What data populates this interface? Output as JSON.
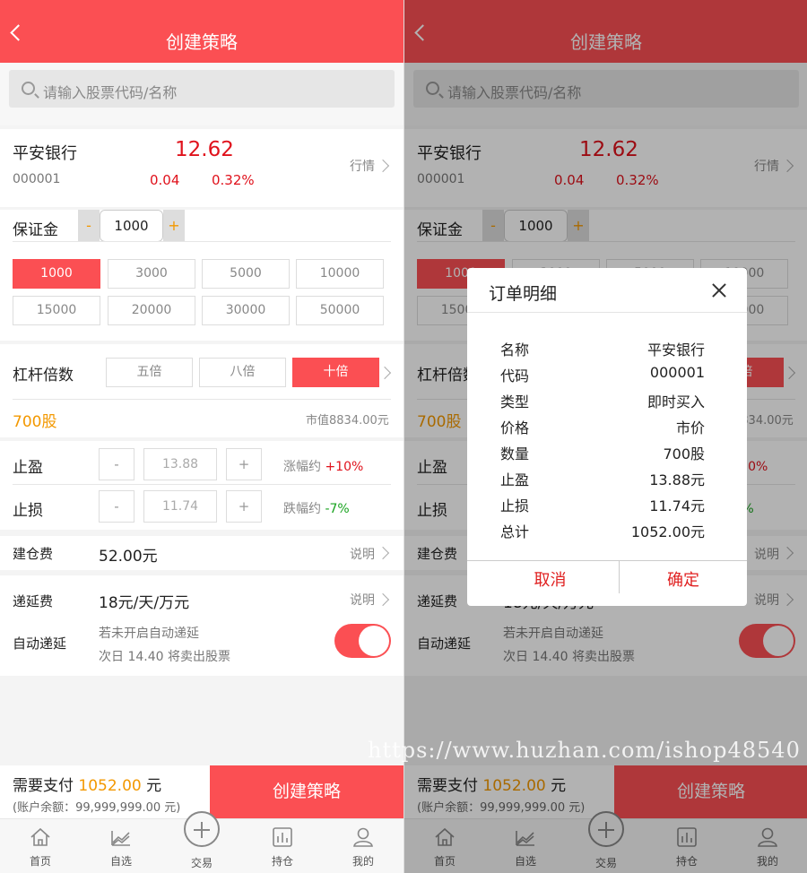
{
  "header": {
    "title": "创建策略"
  },
  "search": {
    "placeholder": "请输入股票代码/名称"
  },
  "stock": {
    "name": "平安银行",
    "code": "000001",
    "price": "12.62",
    "change": "0.04",
    "change_pct": "0.32%",
    "quote_link": "行情"
  },
  "margin": {
    "label": "保证金",
    "minus": "-",
    "plus": "+",
    "value": "1000",
    "options": [
      "1000",
      "3000",
      "5000",
      "10000",
      "15000",
      "20000",
      "30000",
      "50000"
    ],
    "selected": "1000"
  },
  "leverage": {
    "label": "杠杆倍数",
    "options": [
      "五倍",
      "八倍",
      "十倍"
    ],
    "selected": "十倍",
    "shares": "700股",
    "market_value": "市值8834.00元"
  },
  "take_profit": {
    "label": "止盈",
    "minus": "-",
    "plus": "+",
    "value": "13.88",
    "range_label": "涨幅约",
    "range_value": "+10%"
  },
  "stop_loss": {
    "label": "止损",
    "minus": "-",
    "plus": "+",
    "value": "11.74",
    "range_label": "跌幅约",
    "range_value": "-7%"
  },
  "open_fee": {
    "label": "建仓费",
    "value": "52.00元",
    "explain": "说明"
  },
  "deferral": {
    "label": "递延费",
    "value": "18元/天/万元",
    "explain": "说明",
    "auto_label": "自动递延",
    "note1": "若未开启自动递延",
    "note2": "次日 14.40 将卖出股票",
    "auto_on": true
  },
  "payment": {
    "label": "需要支付",
    "amount": "1052.00",
    "unit": "元",
    "balance": "(账户余额：99,999,999.00 元)",
    "create_button": "创建策略"
  },
  "tabbar": [
    {
      "label": "首页",
      "icon": "home-icon"
    },
    {
      "label": "自选",
      "icon": "chart-icon"
    },
    {
      "label": "交易",
      "icon": "plus-circle-icon"
    },
    {
      "label": "持仓",
      "icon": "bar-icon"
    },
    {
      "label": "我的",
      "icon": "user-icon"
    }
  ],
  "modal": {
    "title": "订单明细",
    "rows": [
      {
        "k": "名称",
        "v": "平安银行"
      },
      {
        "k": "代码",
        "v": "000001"
      },
      {
        "k": "类型",
        "v": "即时买入"
      },
      {
        "k": "价格",
        "v": "市价"
      },
      {
        "k": "数量",
        "v": "700股"
      },
      {
        "k": "止盈",
        "v": "13.88元"
      },
      {
        "k": "止损",
        "v": "11.74元"
      },
      {
        "k": "总计",
        "v": "1052.00元"
      }
    ],
    "cancel": "取消",
    "confirm": "确定"
  },
  "watermark": "https://www.huzhan.com/ishop48540",
  "colors": {
    "accent": "#fb4f53",
    "price_red": "#e0121c",
    "orange": "#f39800",
    "green": "#18a31f"
  }
}
